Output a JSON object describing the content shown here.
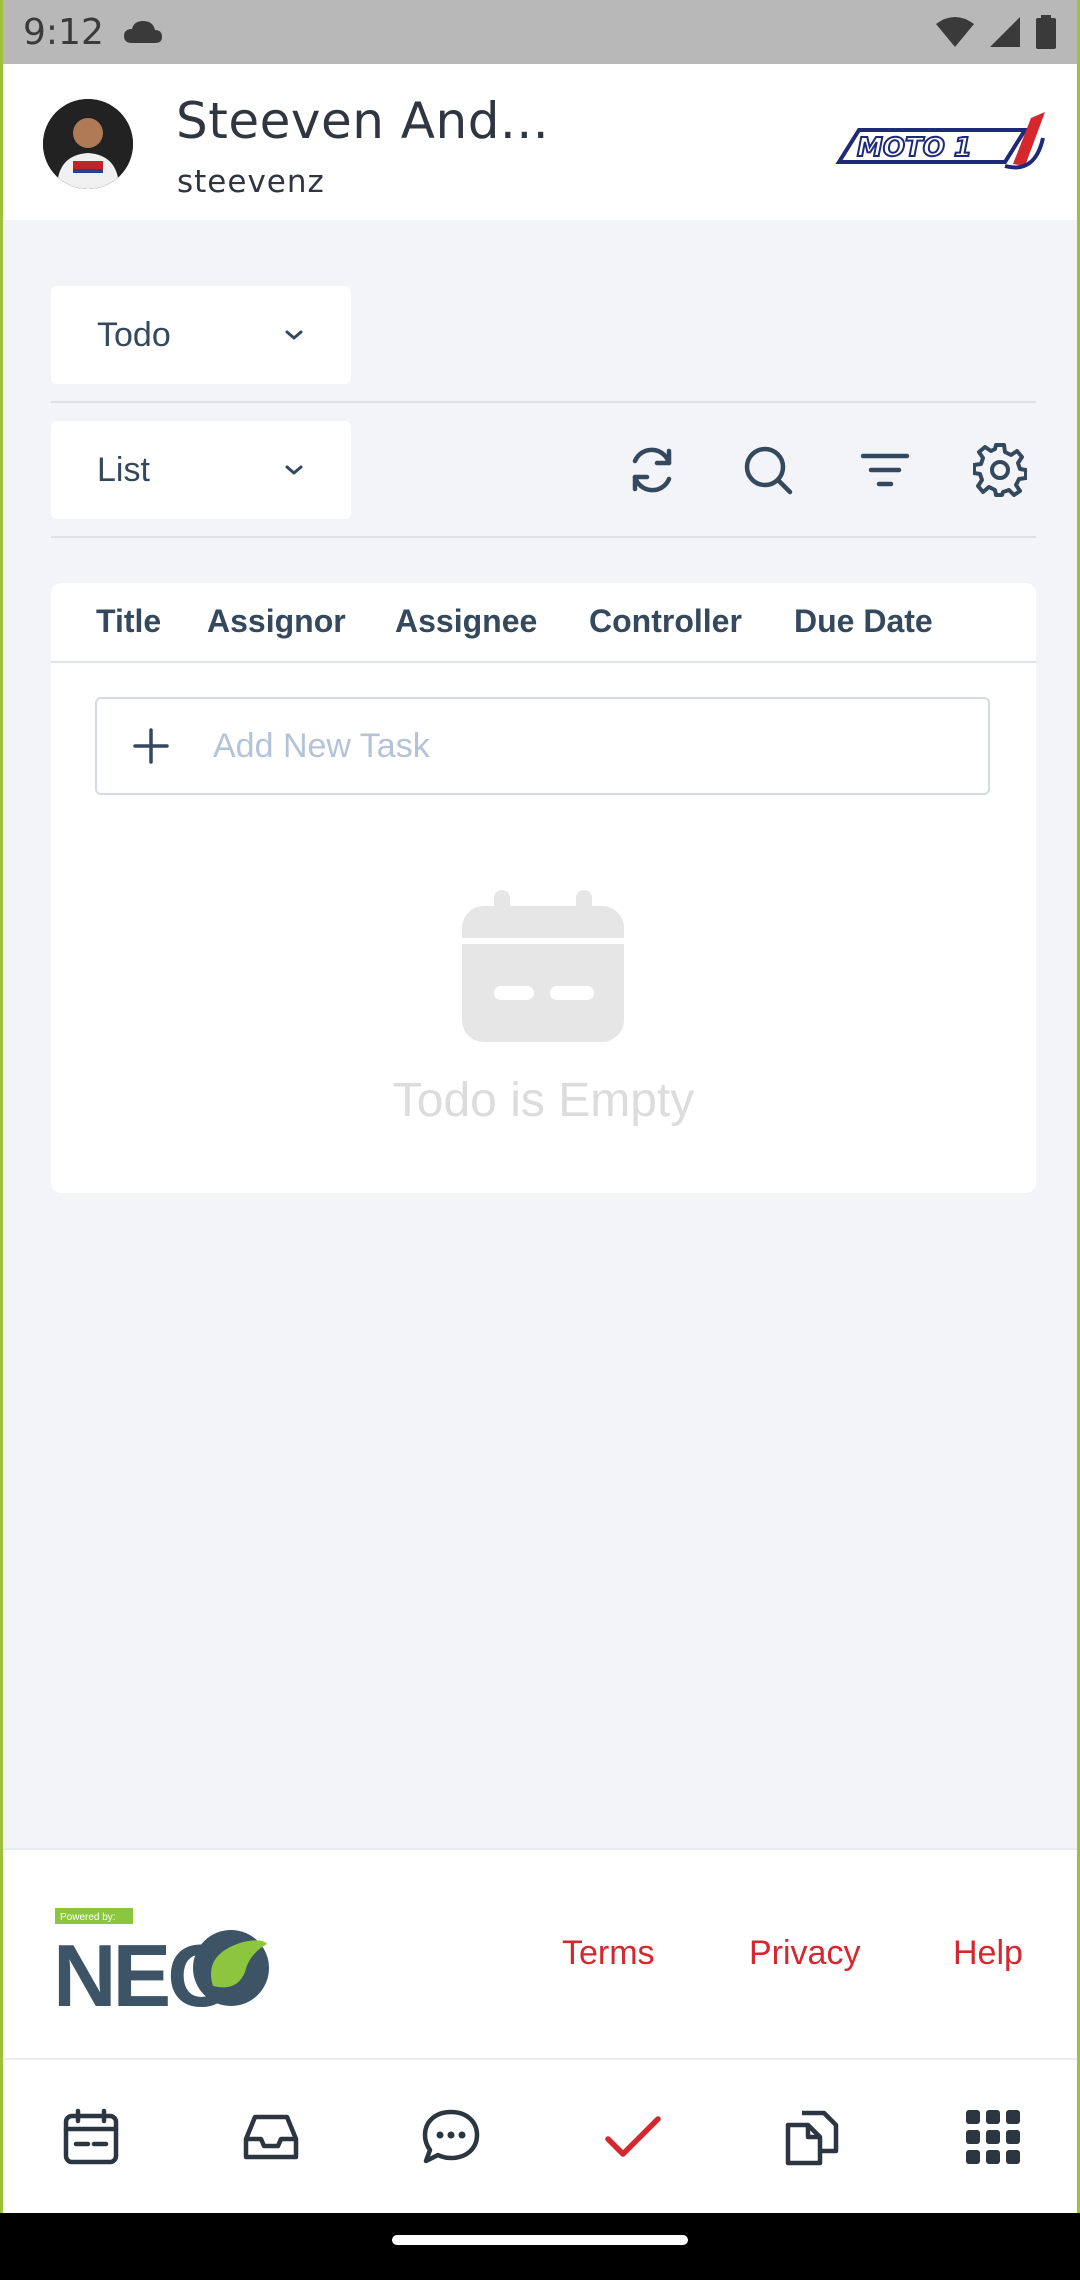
{
  "status_bar": {
    "time": "9:12"
  },
  "header": {
    "name": "Steeven And...",
    "username": "steevenz",
    "brand_logo": "MOTO 1"
  },
  "filters": {
    "category_value": "Todo",
    "view_value": "List"
  },
  "table": {
    "columns": [
      "Title",
      "Assignor",
      "Assignee",
      "Controller",
      "Due Date"
    ],
    "add_task_placeholder": "Add New Task",
    "empty_message": "Todo is Empty"
  },
  "footer": {
    "powered_by": "Powered by:",
    "brand": "NEO",
    "links": [
      "Terms",
      "Privacy",
      "Help"
    ]
  },
  "bottom_nav": {
    "items": [
      "calendar-icon",
      "inbox-icon",
      "chat-icon",
      "check-icon",
      "documents-icon",
      "apps-grid-icon"
    ],
    "active": "check-icon"
  },
  "colors": {
    "accent": "#d4272e",
    "text_primary": "#35495e",
    "background": "#f2f4f8",
    "frame": "#9dc23a"
  }
}
